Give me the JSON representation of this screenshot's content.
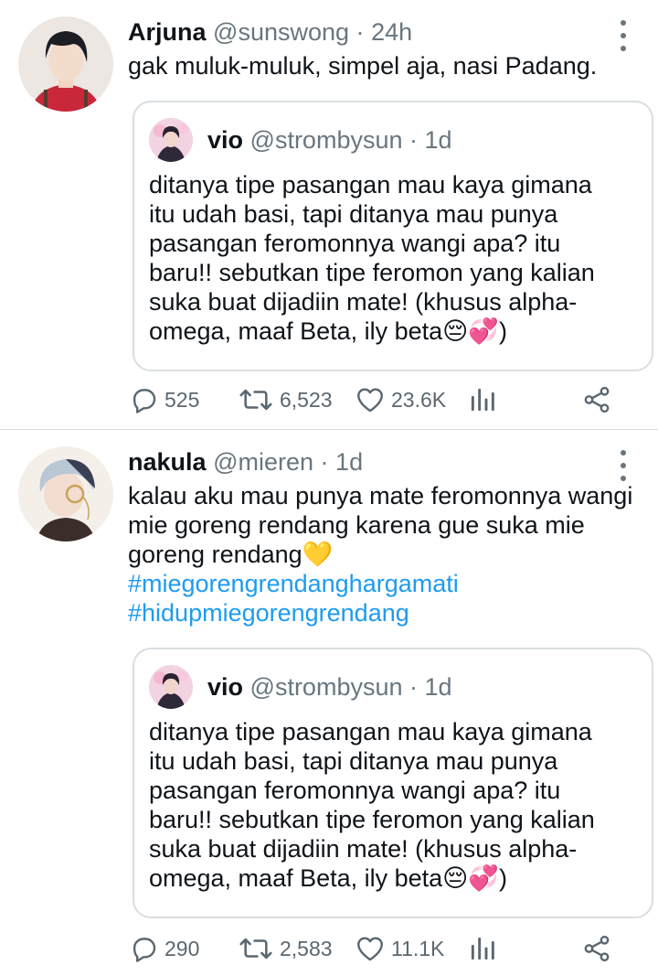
{
  "tweets": [
    {
      "author": {
        "name": "Arjuna",
        "handle": "@sunswong",
        "time": "24h"
      },
      "text": "gak muluk-muluk, simpel aja, nasi Padang.",
      "hashtags": [],
      "quote": {
        "author": {
          "name": "vio",
          "handle": "@strombysun",
          "time": "1d"
        },
        "text": "ditanya tipe pasangan mau kaya gimana itu udah basi, tapi ditanya mau punya pasangan feromonnya wangi apa? itu baru!! sebutkan tipe feromon yang kalian suka buat dijadiin mate! (khusus alpha-omega, maaf Beta, ily beta😔💞)"
      },
      "stats": {
        "replies": "525",
        "retweets": "6,523",
        "likes": "23.6K"
      }
    },
    {
      "author": {
        "name": "nakula",
        "handle": "@mieren",
        "time": "1d"
      },
      "text": "kalau aku mau punya mate feromonnya wangi mie goreng rendang karena gue suka mie goreng rendang💛",
      "hashtags": [
        "#miegorengrendanghargamati",
        "#hidupmiegorengrendang"
      ],
      "quote": {
        "author": {
          "name": "vio",
          "handle": "@strombysun",
          "time": "1d"
        },
        "text": "ditanya tipe pasangan mau kaya gimana itu udah basi, tapi ditanya mau punya pasangan feromonnya wangi apa? itu baru!! sebutkan tipe feromon yang kalian suka buat dijadiin mate! (khusus alpha-omega, maaf Beta, ily beta😔💞)"
      },
      "stats": {
        "replies": "290",
        "retweets": "2,583",
        "likes": "11.1K"
      }
    }
  ],
  "separator": "·",
  "icons": {
    "reply": "reply-icon",
    "retweet": "retweet-icon",
    "like": "heart-icon",
    "analytics": "analytics-icon",
    "share": "share-icon",
    "more": "more-options-icon"
  },
  "colors": {
    "link": "#1d9bf0",
    "muted": "#69767f",
    "border": "#d9dee2",
    "text": "#0f1419"
  }
}
